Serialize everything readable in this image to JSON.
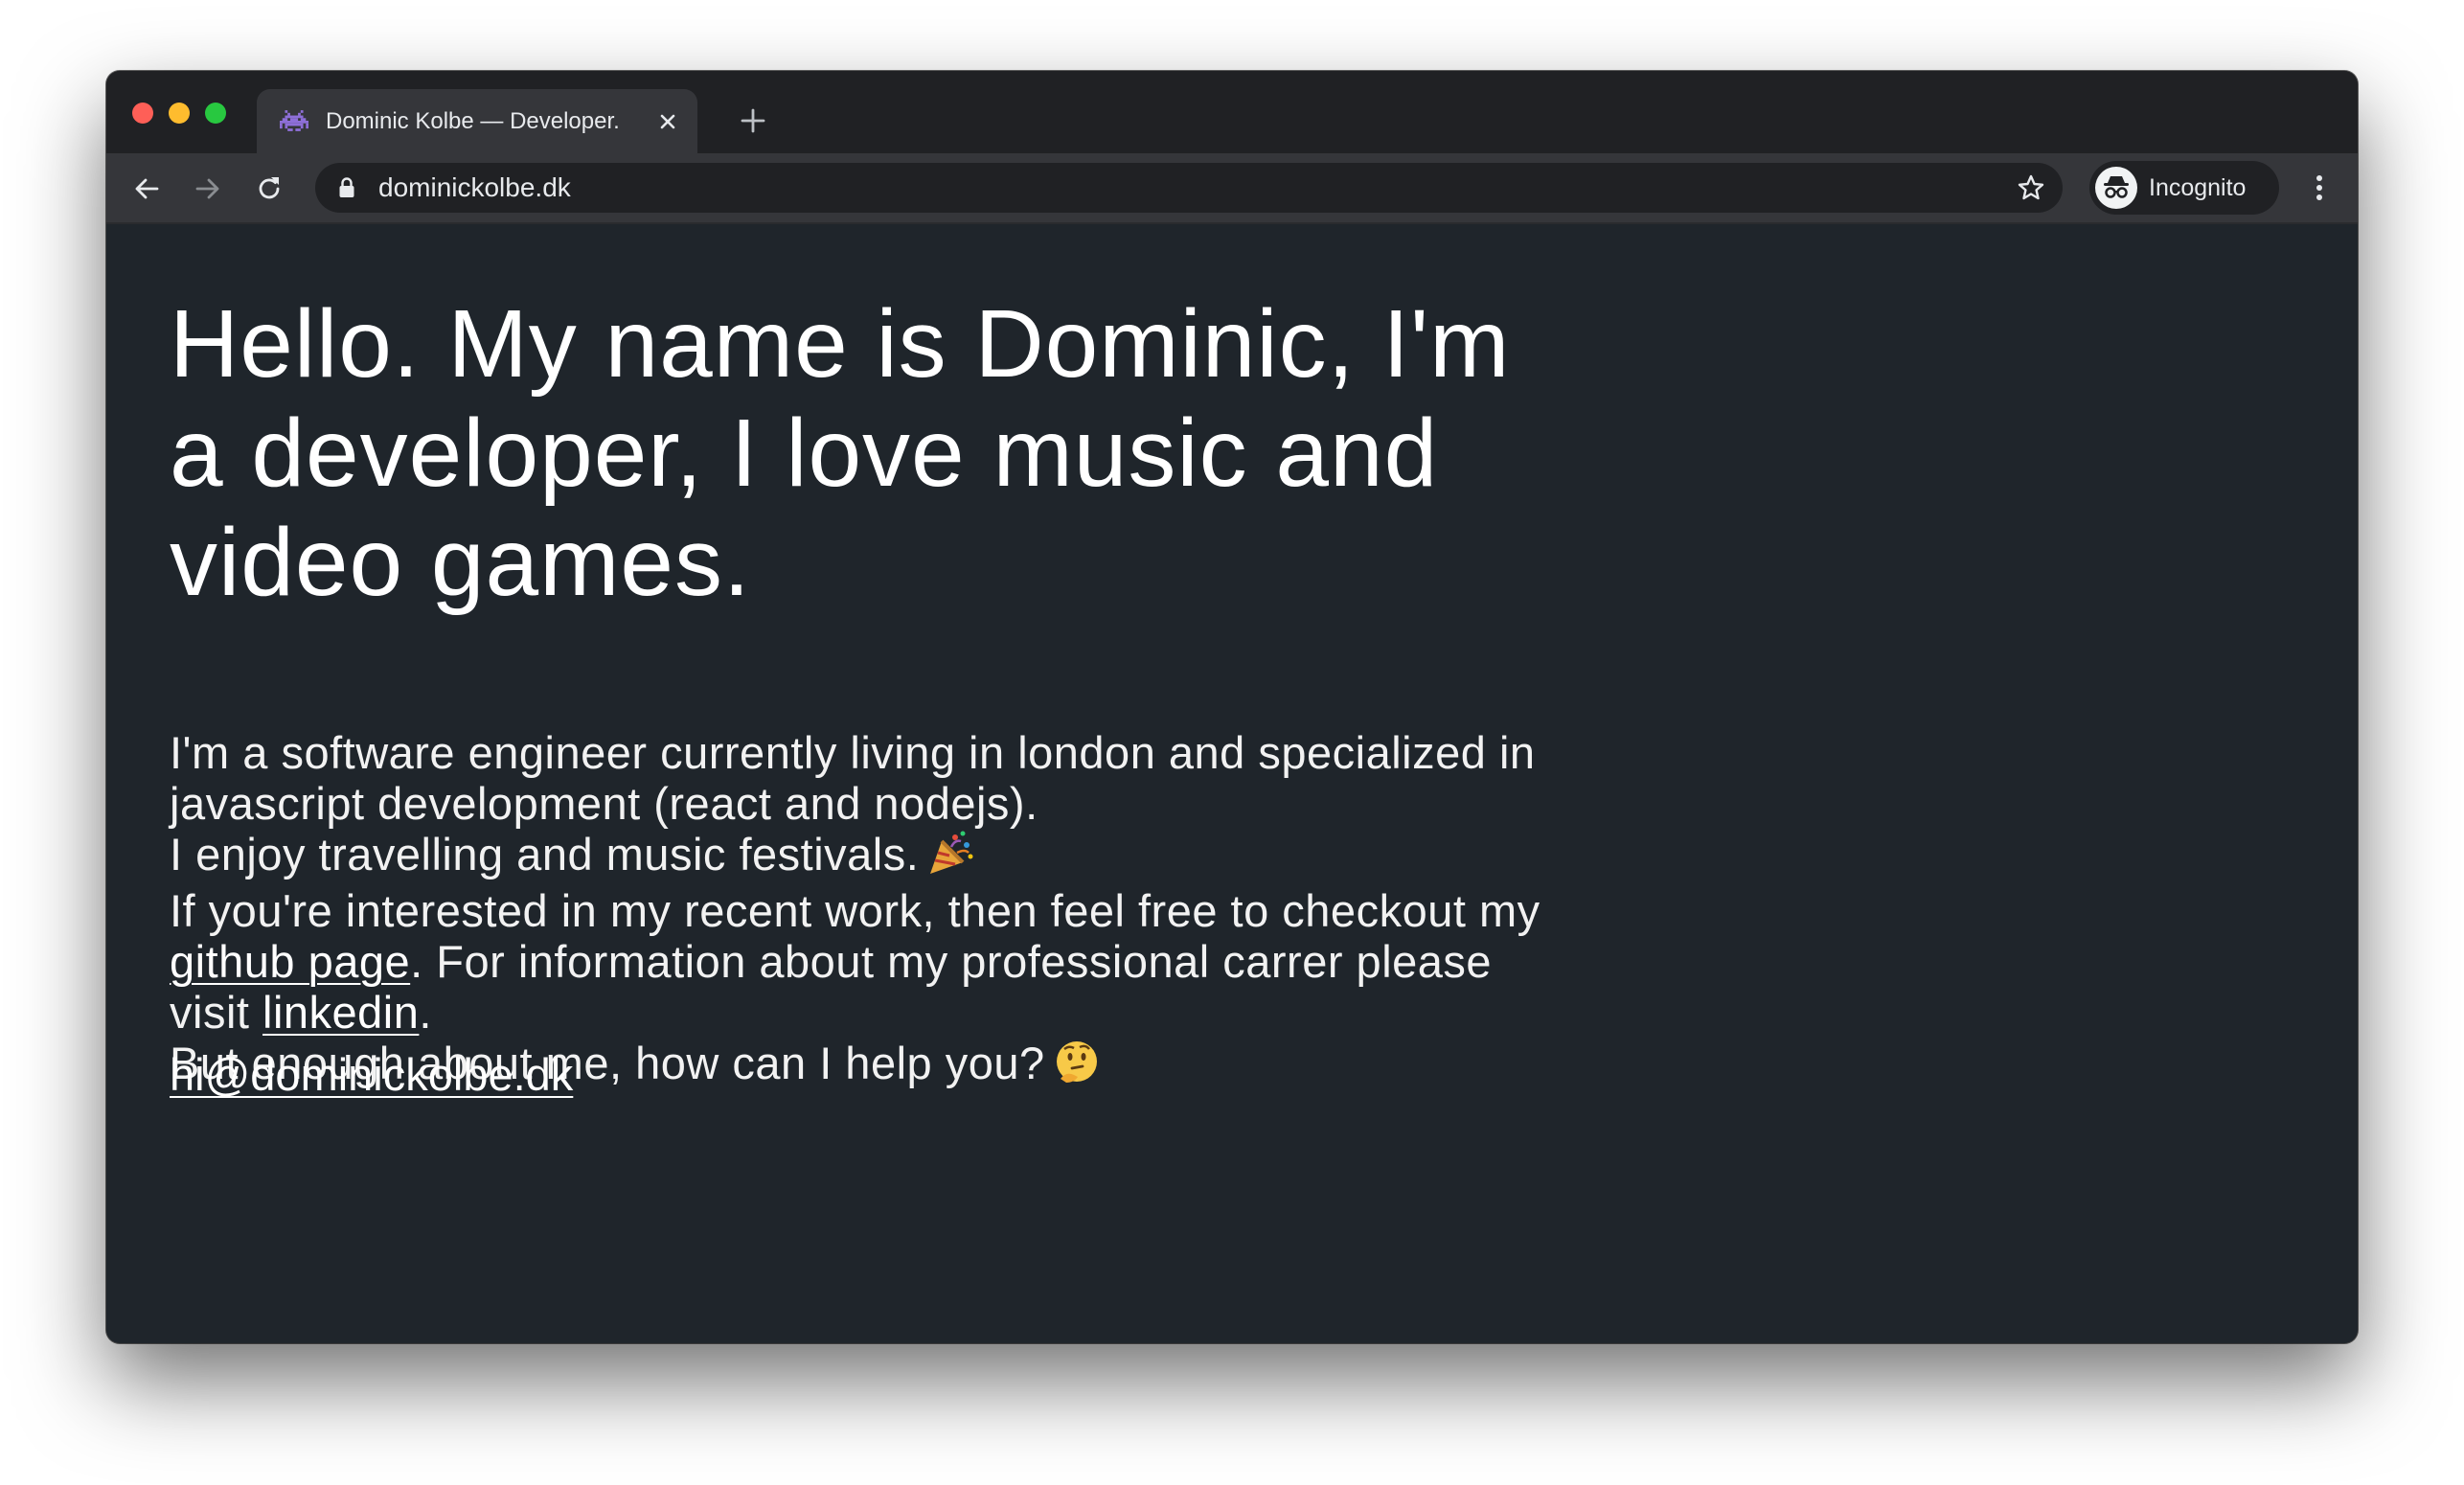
{
  "browser": {
    "tab": {
      "title": "Dominic Kolbe — Developer.",
      "favicon": "space-invader-icon"
    },
    "address_bar": {
      "url": "dominickolbe.dk"
    },
    "incognito_label": "Incognito"
  },
  "page": {
    "headline": "Hello. My name is Dominic, I'm a developer, I love music and video games.",
    "bio": {
      "line1": "I'm a software engineer currently living in london and specialized in javascript development (react and nodejs).",
      "line2": "I enjoy travelling and music festivals.",
      "line3_before": "If you're interested in my recent work, then feel free to checkout my ",
      "github_link": "github page",
      "line3_middle": ". For information about my professional carrer please visit ",
      "linkedin_link": "linkedin",
      "line3_after": ".",
      "line4": "But enough about me, how can I help you?"
    },
    "email": "hi@dominickolbe.dk"
  },
  "colors": {
    "page_background": "#1f252b",
    "chrome_dark": "#202124",
    "chrome_toolbar": "#35363a",
    "text": "#ffffff"
  }
}
